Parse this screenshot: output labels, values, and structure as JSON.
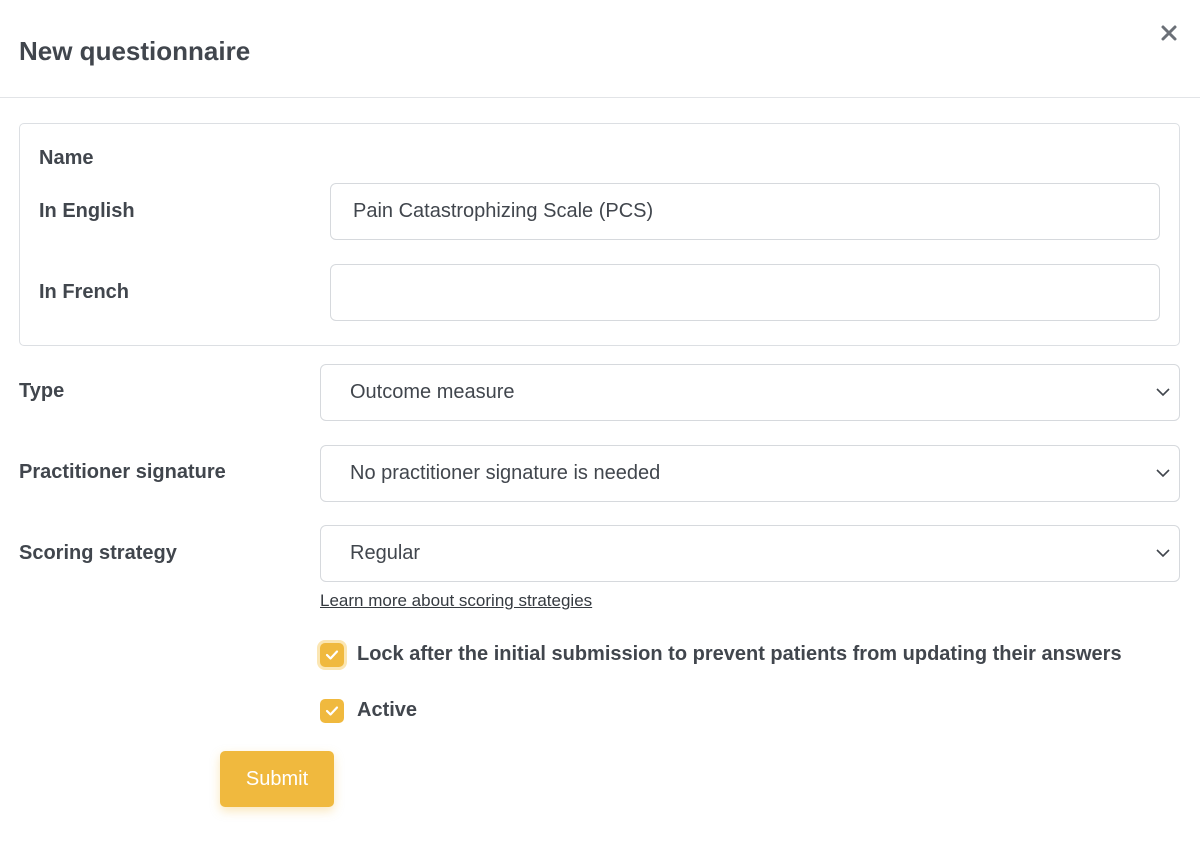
{
  "modal": {
    "title": "New questionnaire",
    "close_icon": "close-icon"
  },
  "name_section": {
    "heading": "Name",
    "english_label": "In English",
    "english_value": "Pain Catastrophizing Scale (PCS)",
    "french_label": "In French",
    "french_value": ""
  },
  "type": {
    "label": "Type",
    "selected": "Outcome measure"
  },
  "practitioner_signature": {
    "label": "Practitioner signature",
    "selected": "No practitioner signature is needed"
  },
  "scoring_strategy": {
    "label": "Scoring strategy",
    "selected": "Regular",
    "help_link": "Learn more about scoring strategies"
  },
  "options": {
    "lock_label": "Lock after the initial submission to prevent patients from updating their answers",
    "lock_checked": true,
    "active_label": "Active",
    "active_checked": true
  },
  "submit_label": "Submit",
  "colors": {
    "accent": "#f0b93e",
    "text": "#41464d",
    "border": "#d6d9dd"
  }
}
